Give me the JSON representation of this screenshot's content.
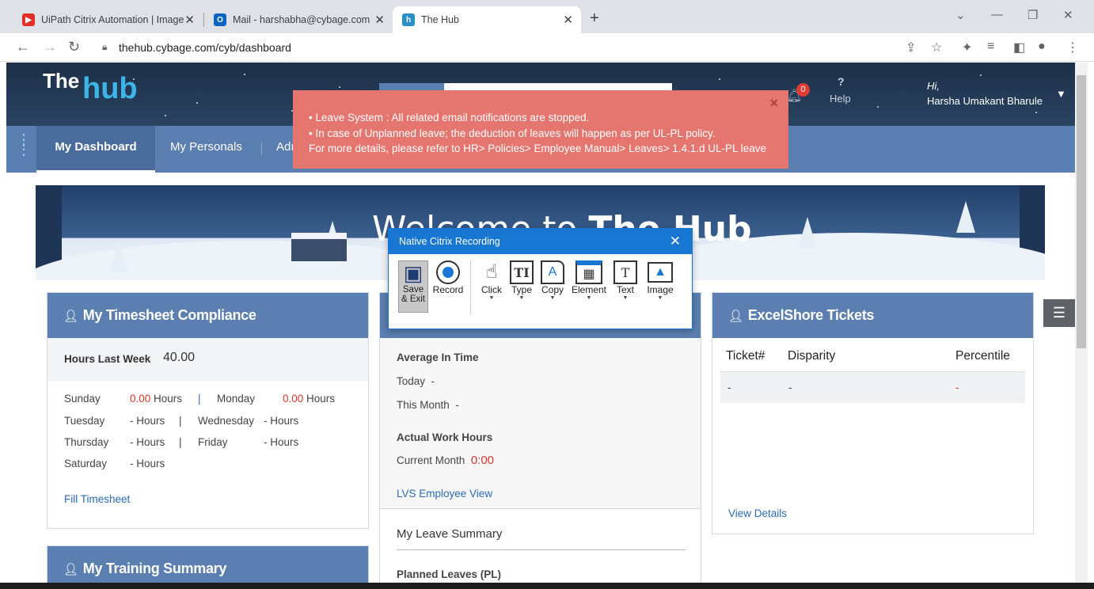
{
  "browser": {
    "tabs": [
      {
        "title": "UiPath Citrix Automation | Image",
        "icon": "youtube-icon"
      },
      {
        "title": "Mail - harshabha@cybage.com",
        "icon": "outlook-icon"
      },
      {
        "title": "The Hub",
        "icon": "hub-icon"
      }
    ],
    "url": "thehub.cybage.com/cyb/dashboard"
  },
  "header": {
    "logo_the": "The",
    "logo_hub": "hub",
    "notification_count": "0",
    "help_symbol": "?",
    "help_label": "Help",
    "greeting": "Hi,",
    "user_name": "Harsha Umakant Bharule"
  },
  "nav": {
    "items": [
      "My Dashboard",
      "My Personals",
      "Adı"
    ]
  },
  "alert": {
    "line1": "• Leave System : All related email notifications are stopped.",
    "line2": "• In case of Unplanned leave; the deduction of leaves will happen as per UL-PL policy.",
    "line3": "For more details, please refer to HR> Policies> Employee Manual> Leaves> 1.4.1.d UL-PL leave"
  },
  "banner": {
    "welcome_prefix": "Welcome to ",
    "welcome_bold": "The Hub"
  },
  "timesheet": {
    "title": "My Timesheet Compliance",
    "hours_last_week_label": "Hours Last Week",
    "hours_last_week_value": "40.00",
    "days": [
      {
        "day": "Sunday",
        "value": "0.00",
        "unit": "Hours"
      },
      {
        "day": "Monday",
        "value": "0.00",
        "unit": "Hours"
      },
      {
        "day": "Tuesday",
        "value": "-",
        "unit": "Hours"
      },
      {
        "day": "Wednesday",
        "value": "-",
        "unit": "Hours"
      },
      {
        "day": "Thursday",
        "value": "-",
        "unit": "Hours"
      },
      {
        "day": "Friday",
        "value": "-",
        "unit": "Hours"
      },
      {
        "day": "Saturday",
        "value": "-",
        "unit": "Hours"
      }
    ],
    "separator": "|",
    "fill_link": "Fill Timesheet"
  },
  "attendance": {
    "avg_in_time_label": "Average In Time",
    "today_label": "Today",
    "today_value": "-",
    "month_label": "This Month",
    "month_value": "-",
    "actual_hours_label": "Actual Work Hours",
    "current_month_label": "Current Month",
    "current_month_value": "0:00",
    "lvs_link": "LVS Employee View",
    "leave_summary_title": "My Leave Summary",
    "planned_leaves_label": "Planned Leaves (PL)"
  },
  "tickets": {
    "title": "ExcelShore Tickets",
    "columns": [
      "Ticket#",
      "Disparity",
      "Percentile"
    ],
    "row": [
      "-",
      "-",
      "-"
    ],
    "view_details": "View Details"
  },
  "training": {
    "title": "My Training Summary"
  },
  "recording_dialog": {
    "title": "Native Citrix Recording",
    "tools": [
      {
        "label": "Save\n& Exit",
        "icon": "save-icon"
      },
      {
        "label": "Record",
        "icon": "record-icon"
      },
      {
        "label": "Click",
        "icon": "click-icon"
      },
      {
        "label": "Type",
        "icon": "type-icon"
      },
      {
        "label": "Copy",
        "icon": "copy-icon"
      },
      {
        "label": "Element",
        "icon": "element-icon"
      },
      {
        "label": "Text",
        "icon": "text-icon"
      },
      {
        "label": "Image",
        "icon": "image-icon"
      }
    ]
  },
  "colors": {
    "header_bg": "#1d2f47",
    "nav_bg": "#5b7fb0",
    "alert_bg": "#e4766f",
    "dialog_accent": "#1877d2",
    "value_red": "#d9332a",
    "link_blue": "#2a6ab8"
  }
}
